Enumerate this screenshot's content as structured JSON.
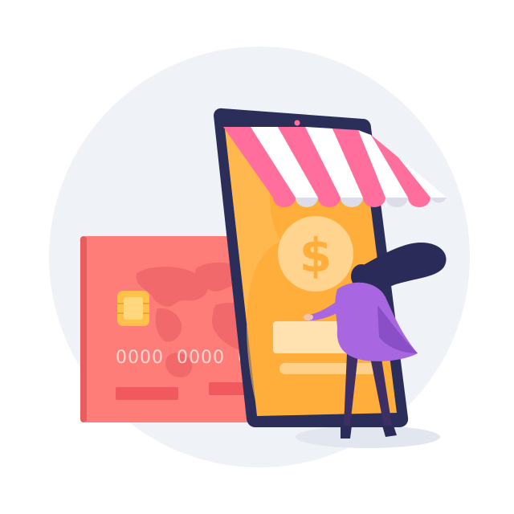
{
  "illustration": {
    "card_number_groups": [
      "0000",
      "0000",
      "0000"
    ],
    "currency_symbol": "$"
  },
  "colors": {
    "background_circle": "#eef1f6",
    "card": "#ff7a7a",
    "card_map": "#f25f65",
    "card_chip": "#ffc34d",
    "phone_frame": "#2c2e5a",
    "phone_screen": "#ffad3b",
    "awning_pink": "#ff6e9c",
    "awning_white": "#ffffff",
    "coin": "#ffd48e",
    "person_top": "#a866e0",
    "person_hair": "#2a2b58",
    "person_legs": "#3d2f64"
  }
}
